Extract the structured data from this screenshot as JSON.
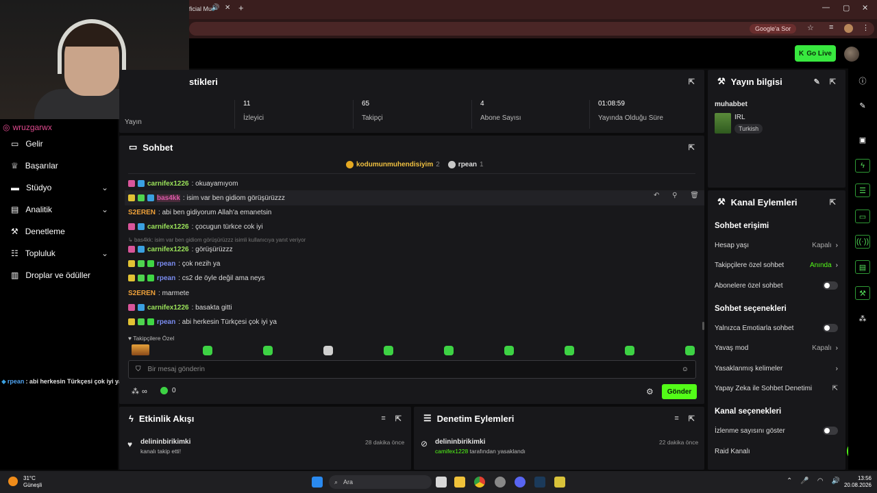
{
  "browser": {
    "tab_title": "ficial Mu",
    "google_search": "Google'a Sor"
  },
  "topbar": {
    "go_live": "Go Live"
  },
  "sidebar": {
    "instagram": "wruzgarwx",
    "items": [
      {
        "label": "Gelir",
        "chevron": false
      },
      {
        "label": "Başarılar",
        "chevron": false
      },
      {
        "label": "Stüdyo",
        "chevron": true
      },
      {
        "label": "Analitik",
        "chevron": true
      },
      {
        "label": "Denetleme",
        "chevron": false
      },
      {
        "label": "Topluluk",
        "chevron": true
      },
      {
        "label": "Droplar ve ödüller",
        "chevron": false
      }
    ]
  },
  "overlay_chat": {
    "user": "rpean",
    "text": ": abi herkesin Türkçesi çok iyi ya"
  },
  "stats": {
    "title_suffix": "stikleri",
    "first_label": "Yayın",
    "items": [
      {
        "value": "11",
        "label": "İzleyici"
      },
      {
        "value": "65",
        "label": "Takipçi"
      },
      {
        "value": "4",
        "label": "Abone Sayısı"
      },
      {
        "value": "01:08:59",
        "label": "Yayında Olduğu Süre"
      }
    ]
  },
  "chat": {
    "title": "Sohbet",
    "leaderboard": [
      {
        "name": "kodumunmuhendisiyim",
        "count": "2"
      },
      {
        "name": "rpean",
        "count": "1"
      }
    ],
    "messages": [
      {
        "user": "carnifex1226",
        "text": ": okuayamıyom",
        "color": "#9be35a"
      },
      {
        "user": "bas4kk",
        "text": ": isim var ben gidiom görüşürüzzz",
        "color": "#d85aa8"
      },
      {
        "user": "S2EREN",
        "text": ": abi ben gidiyorum Allah'a emanetsin",
        "color": "#f0a23a"
      },
      {
        "user": "carnifex1226",
        "text": ": çocugun türkce cok iyi",
        "color": "#9be35a"
      },
      {
        "user": "carnifex1226",
        "text": ": görüşürüzzz",
        "color": "#9be35a"
      },
      {
        "user": "rpean",
        "text": ": çok nezih ya",
        "color": "#7a8cf0"
      },
      {
        "user": "rpean",
        "text": ": cs2 de öyle değil ama neys",
        "color": "#7a8cf0"
      },
      {
        "user": "S2EREN",
        "text": ": marmete",
        "color": "#f0a23a"
      },
      {
        "user": "carnifex1226",
        "text": ": basakta gitti",
        "color": "#9be35a"
      },
      {
        "user": "rpean",
        "text": ": abi herkesin Türkçesi çok iyi ya",
        "color": "#7a8cf0"
      }
    ],
    "reply_note": "bas4kk: isim var ben gidiom görüşürüzzz isimli kullanıcıya yanıt veriyor",
    "followers_only": "Takipçilere Özel",
    "input_placeholder": "Bir mesaj gönderin",
    "points": "∞",
    "kicks": "0",
    "send": "Gönder"
  },
  "activity": {
    "title": "Etkinlik Akışı",
    "items": [
      {
        "name": "delininbirikimki",
        "sub": "kanalı takip etti!",
        "time": "28 dakika önce"
      }
    ]
  },
  "moderation": {
    "title": "Denetim Eylemleri",
    "items": [
      {
        "name": "delininbirikimki",
        "actor": "camifex1228",
        "sub": " tarafından yasaklandı",
        "time": "22 dakika önce"
      }
    ]
  },
  "stream_info": {
    "title": "Yayın bilgisi",
    "stream_title": "muhabbet",
    "category": "IRL",
    "language": "Turkish"
  },
  "channel_actions": {
    "title": "Kanal Eylemleri",
    "chat_access": "Sohbet erişimi",
    "account_age": {
      "label": "Hesap yaşı",
      "value": "Kapalı"
    },
    "followers_chat": {
      "label": "Takipçilere özel sohbet",
      "value": "Anında"
    },
    "subs_chat": "Abonelere özel sohbet",
    "chat_options": "Sohbet seçenekleri",
    "emote_only": "Yalnızca Emotiarla sohbet",
    "slow_mode": {
      "label": "Yavaş mod",
      "value": "Kapalı"
    },
    "banned_words": "Yasaklanmış kelimeler",
    "ai_moderation": "Yapay Zeka ile Sohbet Denetimi",
    "channel_options": "Kanal seçenekleri",
    "show_viewers": "İzlenme sayısını göster",
    "raid": "Raid Kanalı"
  },
  "taskbar": {
    "weather_temp": "31°C",
    "weather_desc": "Güneşli",
    "search": "Ara",
    "time": "13:56",
    "date": "20.08.2026"
  },
  "colors": {
    "accent": "#53fc18",
    "panel": "#18181b",
    "bg": "#0b0b0c"
  }
}
